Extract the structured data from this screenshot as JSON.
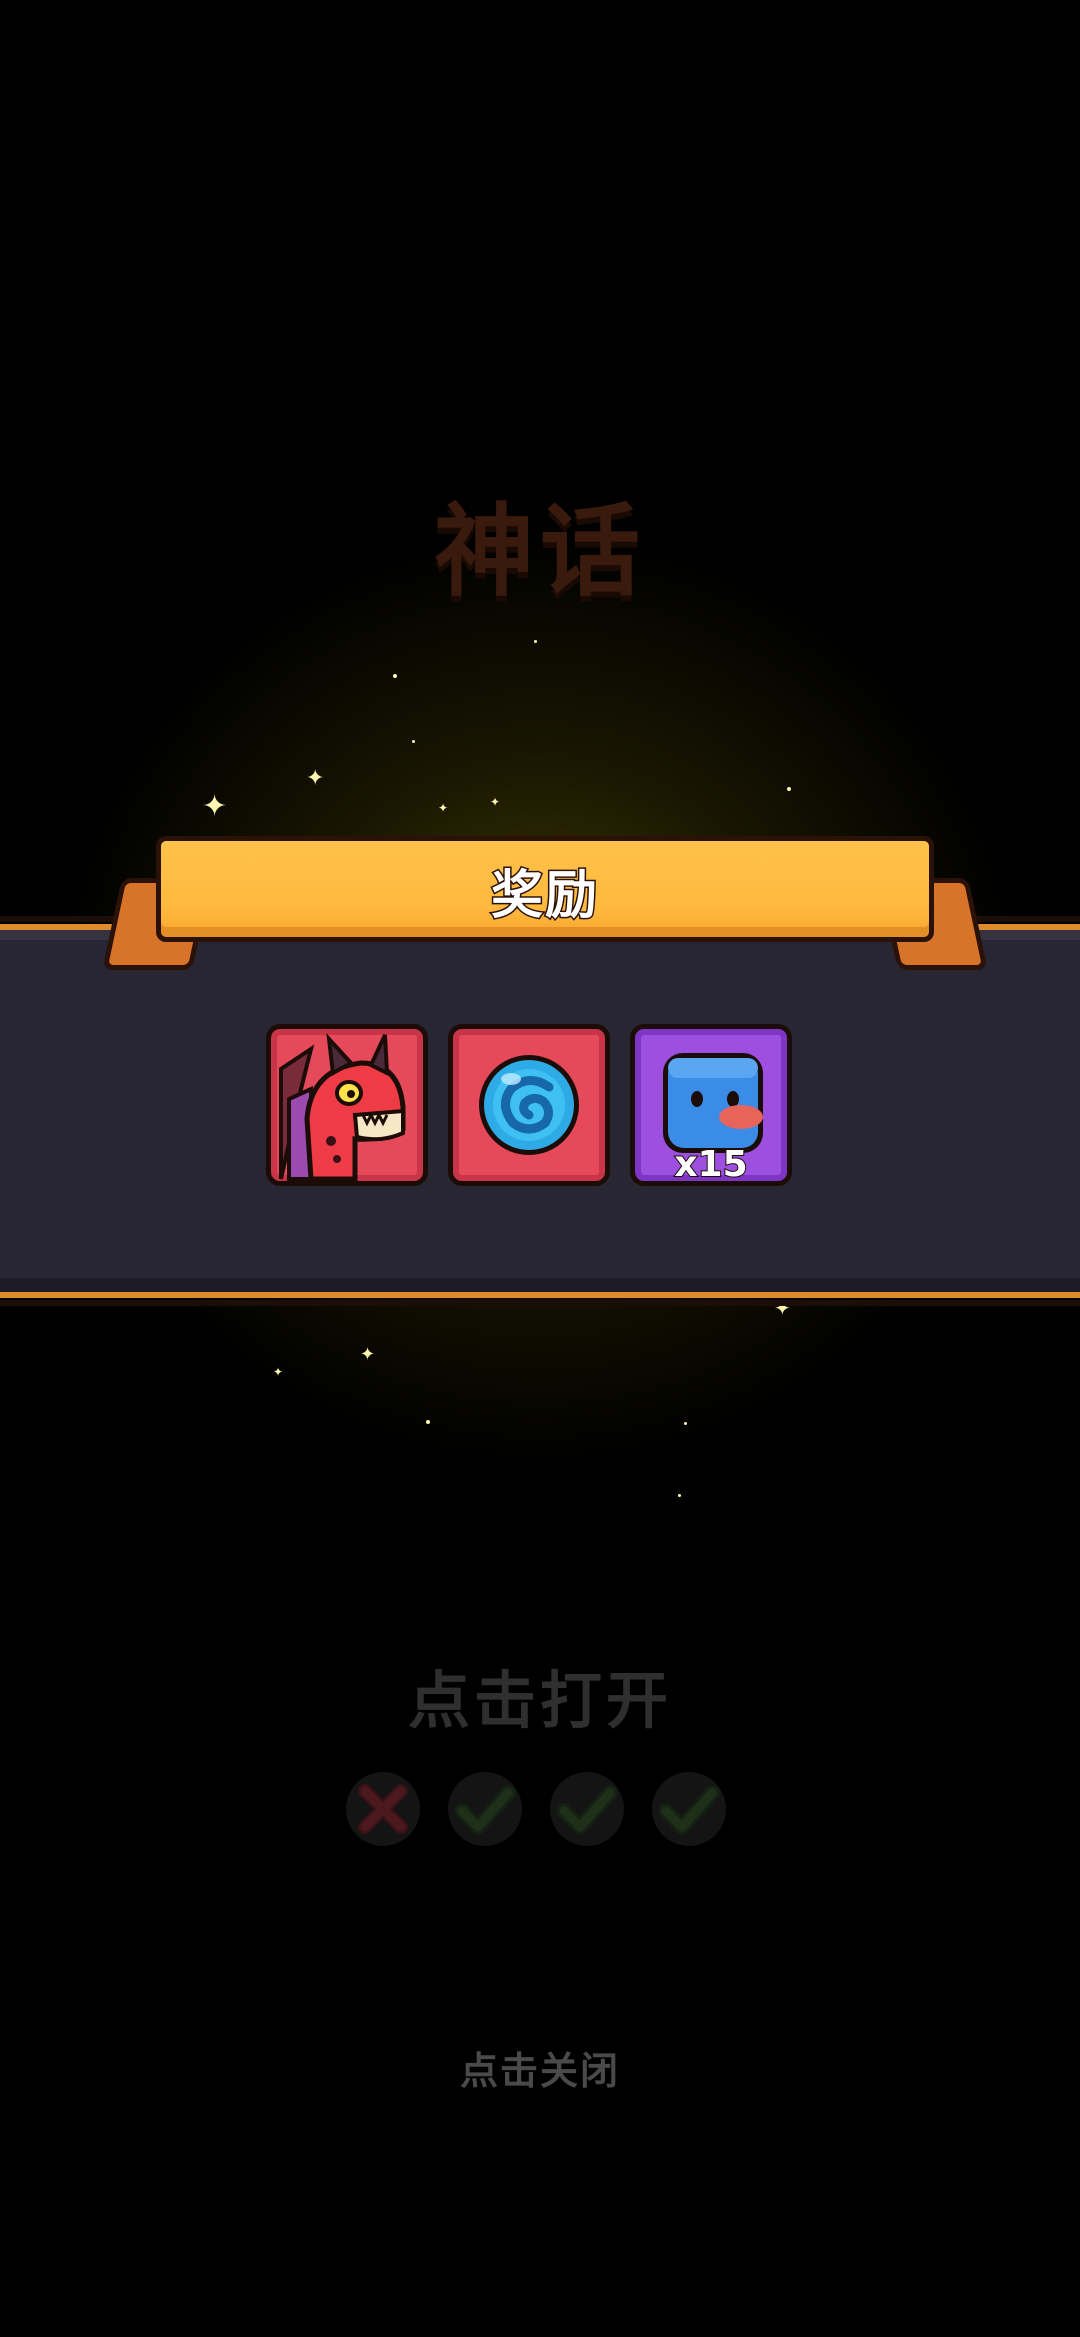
{
  "rarity_title": "神话",
  "reward_banner": {
    "title": "奖励"
  },
  "rewards": [
    {
      "type": "hero",
      "icon": "red-dragon-icon",
      "rarity_color": "#e64a5a"
    },
    {
      "type": "orb",
      "icon": "blue-swirl-orb-icon",
      "rarity_color": "#e64a5a"
    },
    {
      "type": "character_card",
      "icon": "blue-cube-creature-icon",
      "rarity_color": "#9d4fe0",
      "quantity": "x15"
    }
  ],
  "open_hint": "点击打开",
  "attempts": [
    {
      "result": "fail",
      "icon": "cross-icon"
    },
    {
      "result": "success",
      "icon": "check-icon"
    },
    {
      "result": "success",
      "icon": "check-icon"
    },
    {
      "result": "success",
      "icon": "check-icon"
    }
  ],
  "close_hint": "点击关闭",
  "colors": {
    "banner": "#ffb93e",
    "panel": "#282632",
    "panel_border": "#e08a2e",
    "glow": "#786e0a"
  }
}
